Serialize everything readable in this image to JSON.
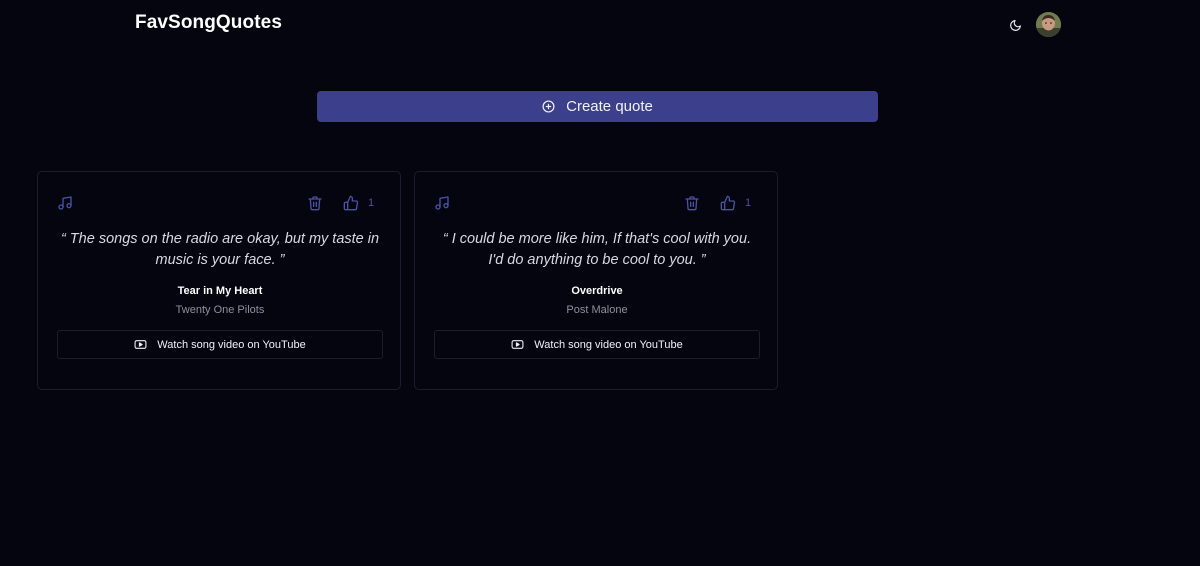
{
  "header": {
    "brand": "FavSongQuotes",
    "theme_icon": "moon-icon",
    "avatar_icon": "user-avatar"
  },
  "actions": {
    "create_label": "Create quote",
    "create_icon": "plus-circle-icon"
  },
  "colors": {
    "background": "#04050f",
    "accent": "#3b3f8c",
    "icon_accent": "#4b51a7",
    "card_border": "#1b1e2e"
  },
  "quotes": [
    {
      "quote": "“ The songs on the radio are okay, but my taste in music is your face. ”",
      "song": "Tear in My Heart",
      "artist": "Twenty One Pilots",
      "likes": "1",
      "video_label": "Watch song video on YouTube"
    },
    {
      "quote": "“ I could be more like him, If that's cool with you. I'd do anything to be cool to you. ”",
      "song": "Overdrive",
      "artist": "Post Malone",
      "likes": "1",
      "video_label": "Watch song video on YouTube"
    }
  ]
}
